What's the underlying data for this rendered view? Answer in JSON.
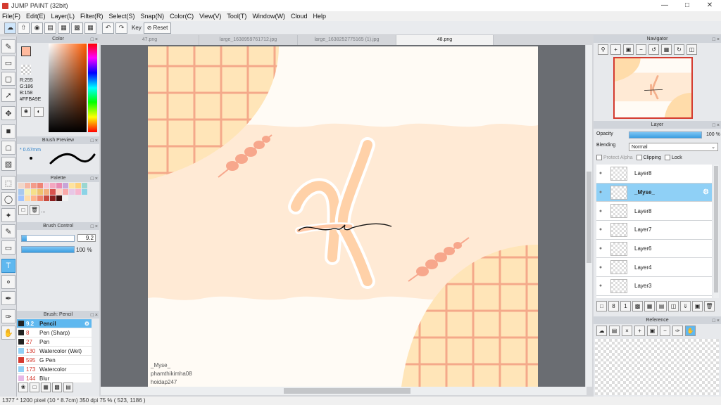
{
  "app": {
    "title": "JUMP PAINT (32bit)",
    "window_controls": [
      "minimize-icon",
      "maximize-icon",
      "close-icon"
    ]
  },
  "menu": [
    "File(F)",
    "Edit(E)",
    "Layer(L)",
    "Filter(R)",
    "Select(S)",
    "Snap(N)",
    "Color(C)",
    "View(V)",
    "Tool(T)",
    "Window(W)",
    "Cloud",
    "Help"
  ],
  "toolbar": {
    "key_label": "Key",
    "reset_label": "Reset"
  },
  "color_panel": {
    "title": "Color",
    "r": "R:255",
    "g": "G:186",
    "b": "B:158",
    "hex": "#FFBA9E",
    "main_color": "#ffba9e"
  },
  "brush_preview": {
    "title": "Brush Preview",
    "size": "* 0.67mm"
  },
  "palette": {
    "title": "Palette",
    "colors": [
      "#f2d7c9",
      "#f7b6a2",
      "#f39c8a",
      "#ef8474",
      "#f7c6d6",
      "#f4a7c0",
      "#e98ab3",
      "#c7a4d8",
      "#ffe39c",
      "#ffd27a",
      "#9bd7d1",
      "#a8c9ef",
      "#f5f0b7",
      "#f6e08a",
      "#f0c36e",
      "#f3b07d",
      "#d9534f",
      "#ffd3c5",
      "#f9a8a8",
      "#e8c7e6",
      "#f7b6d0",
      "#8bd3e6",
      "#a0c4ff",
      "#ffdca8",
      "#ffb38a",
      "#f0856d",
      "#c94b3f",
      "#8b1e1e",
      "#3a1010",
      "#f2f2f2"
    ],
    "more": "..."
  },
  "brush_control": {
    "title": "Brush Control",
    "size_value": "9.2",
    "size_fraction": 0.1,
    "opacity_value": "100 %",
    "opacity_fraction": 1.0
  },
  "brush_list": {
    "title": "Brush: Pencil",
    "items": [
      {
        "size": "9.2",
        "name": "Pencil",
        "color": "#222222"
      },
      {
        "size": "8",
        "name": "Pen (Sharp)",
        "color": "#222222"
      },
      {
        "size": "27",
        "name": "Pen",
        "color": "#222222"
      },
      {
        "size": "130",
        "name": "Watercolor (Wet)",
        "color": "#8fd0f6"
      },
      {
        "size": "595",
        "name": "G Pen",
        "color": "#d43a2f"
      },
      {
        "size": "173",
        "name": "Watercolor",
        "color": "#8fd0f6"
      },
      {
        "size": "144",
        "name": "Blur",
        "color": "#e6b8e6"
      }
    ]
  },
  "tabs": [
    "47.png",
    "large_1638959761712.jpg",
    "large_1638252775165 (1).jpg",
    "48.png"
  ],
  "canvas": {
    "signature_line1": "_Myse_",
    "signature_line2": "phamthikimha08",
    "signature_line3": "hoidap247"
  },
  "status": "1377 * 1200 pixel  (10 * 8.7cm)  350 dpi  75 %  ( 523, 1186 )",
  "navigator": {
    "title": "Navigator"
  },
  "layer_panel": {
    "title": "Layer",
    "opacity_label": "Opacity",
    "opacity_value": "100 %",
    "blending_label": "Blending",
    "blending_value": "Normal",
    "protect_alpha": "Protect Alpha",
    "clipping": "Clipping",
    "lock": "Lock",
    "layers": [
      {
        "name": "Layer8",
        "selected": false
      },
      {
        "name": "_Myse_",
        "selected": true
      },
      {
        "name": "Layer8",
        "selected": false
      },
      {
        "name": "Layer7",
        "selected": false
      },
      {
        "name": "Layer6",
        "selected": false
      },
      {
        "name": "Layer4",
        "selected": false
      },
      {
        "name": "Layer3",
        "selected": false
      }
    ]
  },
  "reference": {
    "title": "Reference"
  }
}
